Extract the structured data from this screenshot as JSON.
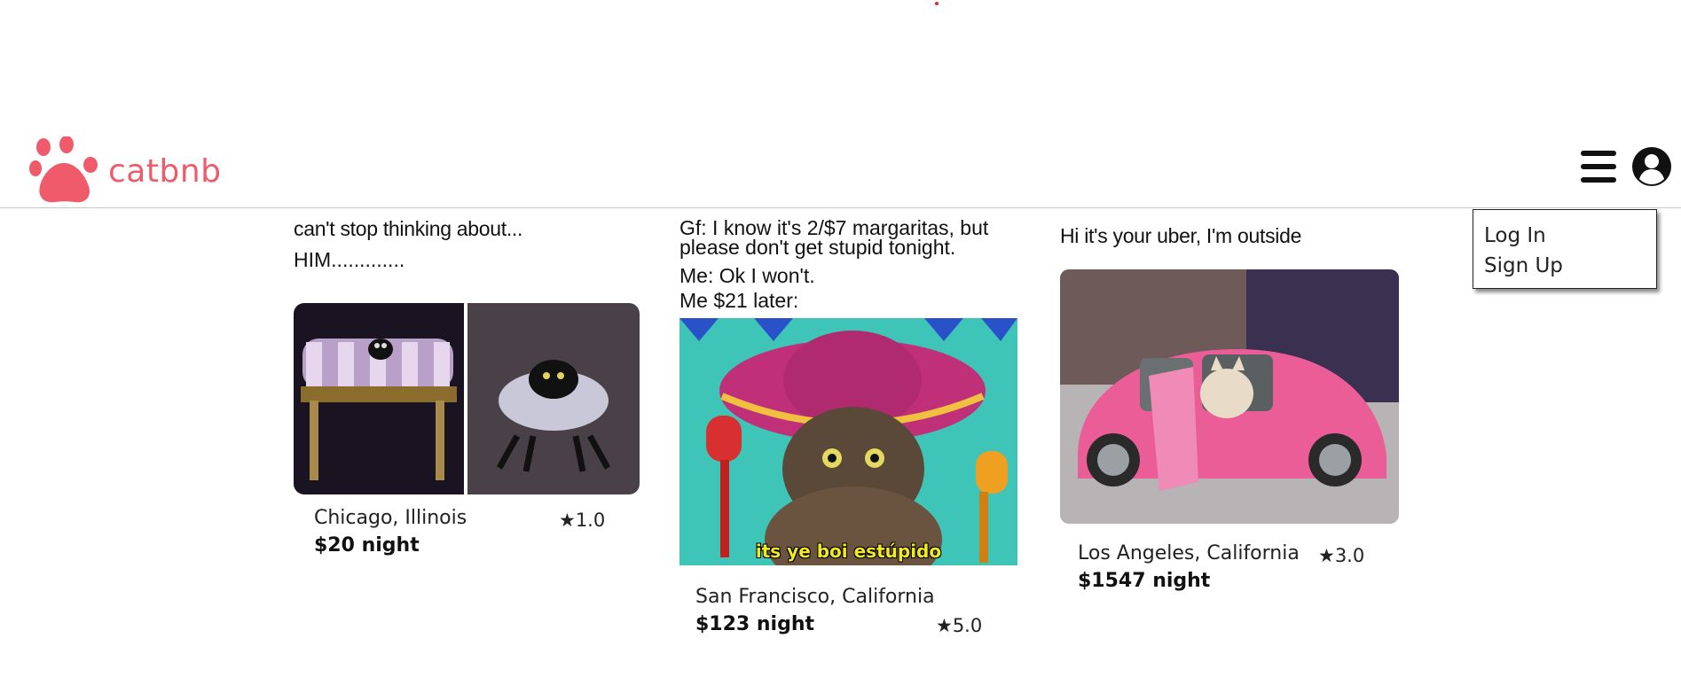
{
  "app": {
    "brand": "catbnb",
    "brand_color": "#ef5b6a"
  },
  "header": {
    "menu_icon": "hamburger-icon",
    "profile_icon": "user-circle-icon"
  },
  "dropdown": {
    "items": [
      {
        "label": "Log In"
      },
      {
        "label": "Sign Up"
      }
    ]
  },
  "listings": [
    {
      "caption_lines": [
        "can't stop thinking about...",
        "HIM............."
      ],
      "location": "Chicago, Illinois",
      "price": "$20 night",
      "rating": "★1.0",
      "image": "cat on ottoman"
    },
    {
      "caption_lines": [
        "Gf: I know it's 2/$7 margaritas, but",
        "please don't get stupid tonight.",
        "Me: Ok I won't.",
        "Me $21 later:"
      ],
      "meme_text": "its ye boi estúpido",
      "location": "San Francisco, California",
      "price": "$123 night",
      "rating": "★5.0",
      "image": "cat in sombrero with maracas"
    },
    {
      "caption_lines": [
        "Hi it's your uber, I'm outside"
      ],
      "location": "Los Angeles, California",
      "price": "$1547 night",
      "rating": "★3.0",
      "image": "cat in pink toy car"
    }
  ]
}
